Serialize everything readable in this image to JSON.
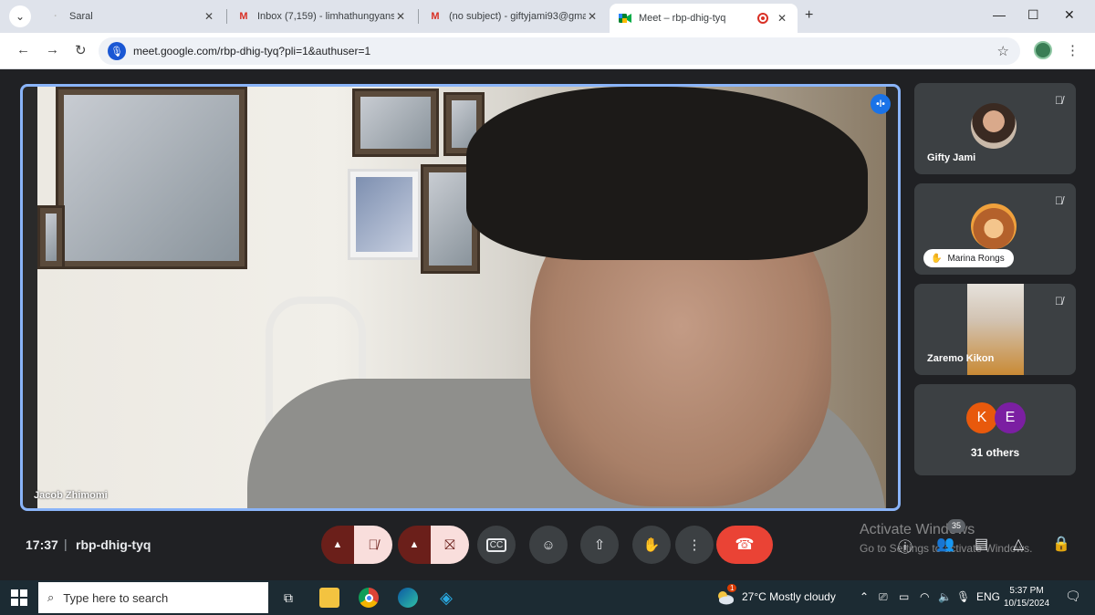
{
  "browser": {
    "tabs": [
      {
        "title": "Saral",
        "favicon": "dot"
      },
      {
        "title": "Inbox (7,159) - limhathungyans",
        "favicon": "M"
      },
      {
        "title": "(no subject) - giftyjami93@gma",
        "favicon": "M"
      },
      {
        "title": "Meet – rbp-dhig-tyq",
        "favicon": "meet",
        "active": true
      }
    ],
    "url": "meet.google.com/rbp-dhig-tyq?pli=1&authuser=1"
  },
  "meet": {
    "main_participant": "Jacob Zhimomi",
    "participants": [
      {
        "name": "Gifty Jami",
        "muted": true
      },
      {
        "name": "Marina Rongs",
        "muted": true
      },
      {
        "name": "Zaremo Kikon",
        "muted": true
      }
    ],
    "others": {
      "initials": [
        "K",
        "E"
      ],
      "label": "31 others",
      "colors": [
        "#e8590c",
        "#7b1fa2"
      ]
    },
    "time": "17:37",
    "code": "rbp-dhig-tyq",
    "people_count": "35",
    "colors": {
      "end_call": "#ea4335",
      "muted_bg": "#f9dedc",
      "active_border": "#8ab4f8"
    }
  },
  "watermark": {
    "line1": "Activate Windows",
    "line2": "Go to Settings to activate Windows."
  },
  "taskbar": {
    "search_placeholder": "Type here to search",
    "weather": "27°C  Mostly cloudy",
    "weather_badge": "1",
    "lang": "ENG",
    "time": "5:37 PM",
    "date": "10/15/2024"
  }
}
